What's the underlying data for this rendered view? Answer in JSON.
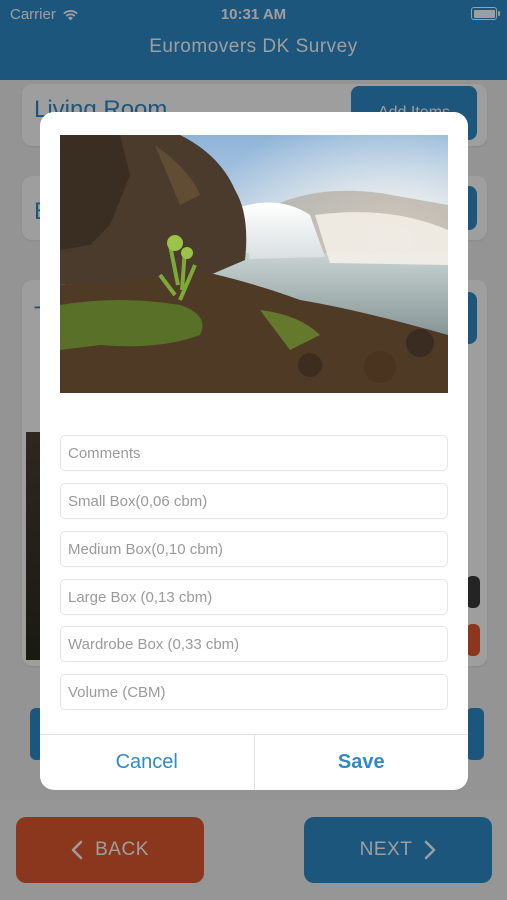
{
  "status_bar": {
    "carrier": "Carrier",
    "time": "10:31 AM"
  },
  "nav": {
    "title": "Euromovers DK Survey"
  },
  "background": {
    "room_title": "Living Room",
    "add_items_label": "Add Items",
    "room2_initial": "B",
    "room3_initial": "T"
  },
  "footer": {
    "back_label": "BACK",
    "next_label": "NEXT"
  },
  "dialog": {
    "fields": {
      "comments": "Comments",
      "small_box": "Small Box(0,06 cbm)",
      "medium_box": "Medium Box(0,10 cbm)",
      "large_box": "Large Box (0,13 cbm)",
      "wardrobe_box": "Wardrobe Box (0,33 cbm)",
      "volume": "Volume (CBM)"
    },
    "cancel_label": "Cancel",
    "save_label": "Save"
  },
  "colors": {
    "primary_blue": "#2f8bc8",
    "accent_orange": "#e05a2f",
    "overlay": "rgba(0,0,0,0.38)"
  },
  "icons": [
    "wifi-icon",
    "battery-icon",
    "chevron-left-icon",
    "chevron-right-icon"
  ]
}
